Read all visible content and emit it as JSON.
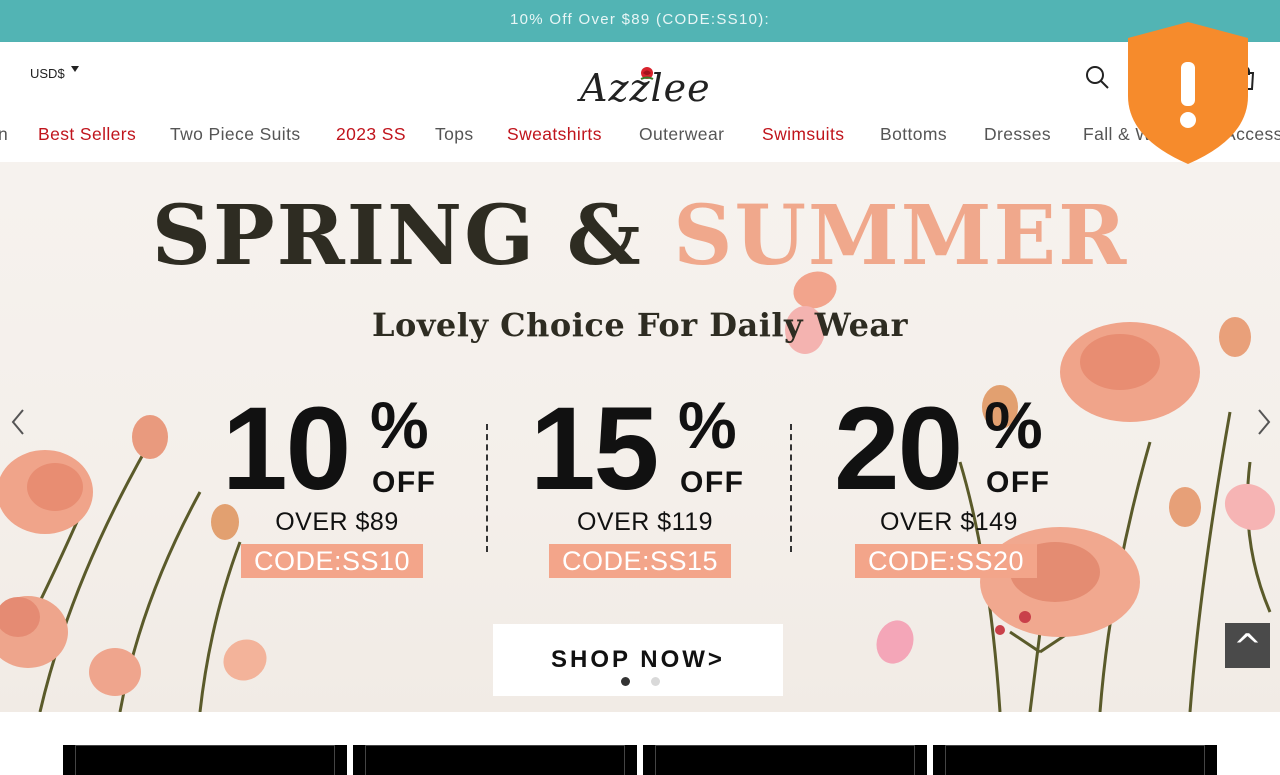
{
  "promo": {
    "text": "10% Off Over $89 (CODE:SS10):"
  },
  "header": {
    "currency": "USD$",
    "logo_text": "Azzlee"
  },
  "nav": {
    "items": [
      {
        "label": "n",
        "highlight": false
      },
      {
        "label": "Best Sellers",
        "highlight": true
      },
      {
        "label": "Two Piece Suits",
        "highlight": false
      },
      {
        "label": "2023 SS",
        "highlight": true
      },
      {
        "label": "Tops",
        "highlight": false
      },
      {
        "label": "Sweatshirts",
        "highlight": true
      },
      {
        "label": "Outerwear",
        "highlight": false
      },
      {
        "label": "Swimsuits",
        "highlight": true
      },
      {
        "label": "Bottoms",
        "highlight": false
      },
      {
        "label": "Dresses",
        "highlight": false
      },
      {
        "label": "Fall & W",
        "highlight": false
      },
      {
        "label": "Access",
        "highlight": false
      }
    ]
  },
  "hero": {
    "headline_word1": "SPRING &",
    "headline_word2": "SUMMER",
    "subline": "Lovely Choice For Daily Wear",
    "offers": [
      {
        "percent": "10",
        "pct_sign": "%",
        "off": "OFF",
        "threshold": "OVER $89",
        "code": "CODE:SS10"
      },
      {
        "percent": "15",
        "pct_sign": "%",
        "off": "OFF",
        "threshold": "OVER $119",
        "code": "CODE:SS15"
      },
      {
        "percent": "20",
        "pct_sign": "%",
        "off": "OFF",
        "threshold": "OVER $149",
        "code": "CODE:SS20"
      }
    ],
    "cta": "SHOP NOW>",
    "slides": {
      "count": 2,
      "active": 1
    }
  },
  "scroll_top": {
    "glyph": "^"
  },
  "colors": {
    "promo_bg": "#52b4b4",
    "nav_highlight": "#c0141c",
    "headline_dark": "#2e2c22",
    "headline_peach": "#f0a88c",
    "code_bg": "#f3a58a",
    "shield": "#f68b2c"
  },
  "icons": [
    "chevron-down-icon",
    "search-icon",
    "cart-icon",
    "shield-alert-icon",
    "chevron-left-icon",
    "chevron-right-icon",
    "scroll-top-icon"
  ]
}
